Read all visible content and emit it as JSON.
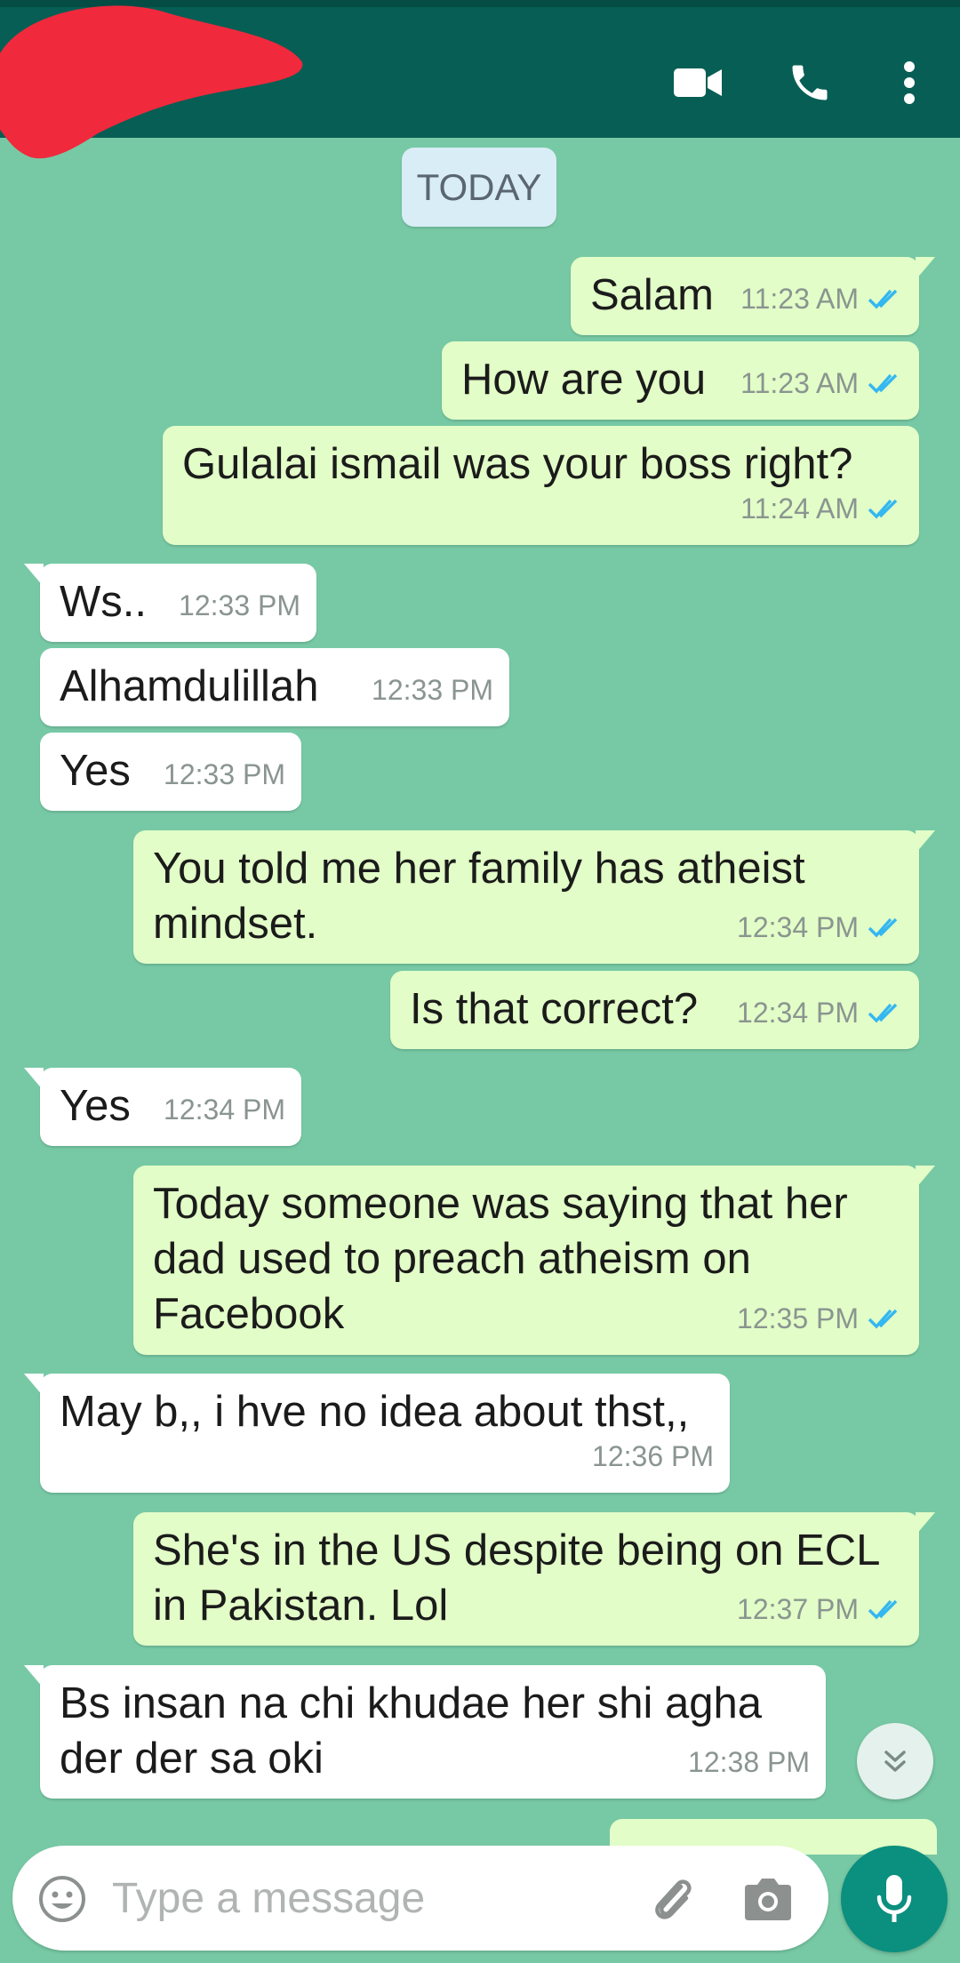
{
  "header": {
    "icons": [
      "video-call-icon",
      "voice-call-icon",
      "more-options-icon"
    ]
  },
  "day_chip": "TODAY",
  "messages": [
    {
      "dir": "out",
      "text": "Salam",
      "time": "11:23 AM",
      "status": "read"
    },
    {
      "dir": "out",
      "text": "How are you",
      "time": "11:23 AM",
      "status": "read"
    },
    {
      "dir": "out",
      "text": "Gulalai ismail was your boss right?",
      "time": "11:24 AM",
      "status": "read"
    },
    {
      "dir": "in",
      "text": "Ws..",
      "time": "12:33 PM"
    },
    {
      "dir": "in",
      "text": "Alhamdulillah",
      "time": "12:33 PM"
    },
    {
      "dir": "in",
      "text": "Yes",
      "time": "12:33 PM"
    },
    {
      "dir": "out",
      "text": "You told me her family has atheist mindset.",
      "time": "12:34 PM",
      "status": "read"
    },
    {
      "dir": "out",
      "text": "Is that correct?",
      "time": "12:34 PM",
      "status": "read"
    },
    {
      "dir": "in",
      "text": "Yes",
      "time": "12:34 PM"
    },
    {
      "dir": "out",
      "text": "Today someone was saying that her dad used to preach atheism on Facebook",
      "time": "12:35 PM",
      "status": "read"
    },
    {
      "dir": "in",
      "text": "May b,, i hve no idea about thst,,",
      "time": "12:36 PM"
    },
    {
      "dir": "out",
      "text": "She's in the US despite being on ECL in Pakistan. Lol",
      "time": "12:37 PM",
      "status": "read"
    },
    {
      "dir": "in",
      "text": "Bs insan na chi khudae her shi agha der der sa oki",
      "time": "12:38 PM"
    }
  ],
  "composer": {
    "placeholder": "Type a message",
    "icons": [
      "emoji-icon",
      "attach-icon",
      "camera-icon",
      "microphone-icon"
    ]
  },
  "colors": {
    "header": "#075e54",
    "chat_background": "#77c9a5",
    "outgoing_bubble": "#e2fdc7",
    "incoming_bubble": "#ffffff",
    "read_ticks": "#34b7f1",
    "mic_button": "#0b8f7f"
  }
}
